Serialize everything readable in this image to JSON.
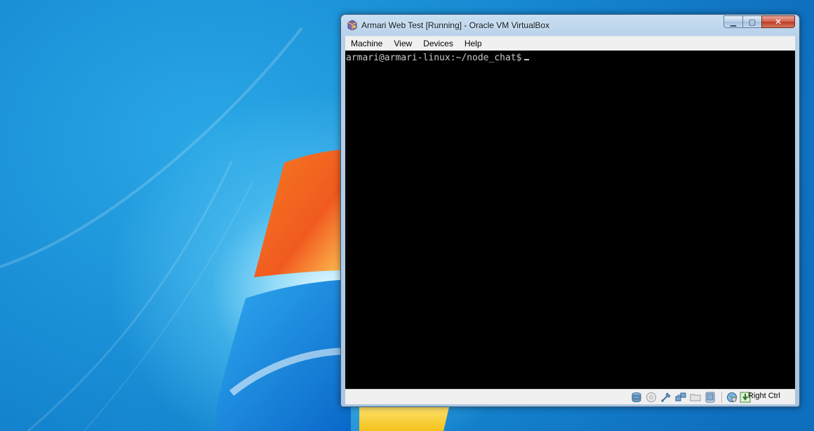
{
  "window": {
    "title": "Armari Web Test [Running] - Oracle VM VirtualBox",
    "app_icon": "virtualbox-icon",
    "controls": {
      "minimize_icon": "minimize-icon",
      "maximize_icon": "maximize-icon",
      "close_icon": "close-icon",
      "minimize_glyph": "▁",
      "maximize_glyph": "▢",
      "close_glyph": "✕"
    }
  },
  "menubar": {
    "items": [
      {
        "label": "Machine"
      },
      {
        "label": "View"
      },
      {
        "label": "Devices"
      },
      {
        "label": "Help"
      }
    ]
  },
  "terminal": {
    "prompt": "armari@armari-linux:~/node_chat$"
  },
  "statusbar": {
    "icons": [
      "hard-disk-icon",
      "optical-drive-icon",
      "usb-icon",
      "network-icon",
      "shared-folders-icon",
      "mouse-integration-icon",
      "keyboard-capture-icon"
    ],
    "host_key_label": "Right Ctrl"
  },
  "desktop": {
    "wallpaper": "windows-7-logo"
  },
  "colors": {
    "terminal_bg": "#000000",
    "terminal_fg": "#c8c8c8",
    "desktop_blue": "#1a8fd6",
    "close_red": "#c8452c"
  }
}
